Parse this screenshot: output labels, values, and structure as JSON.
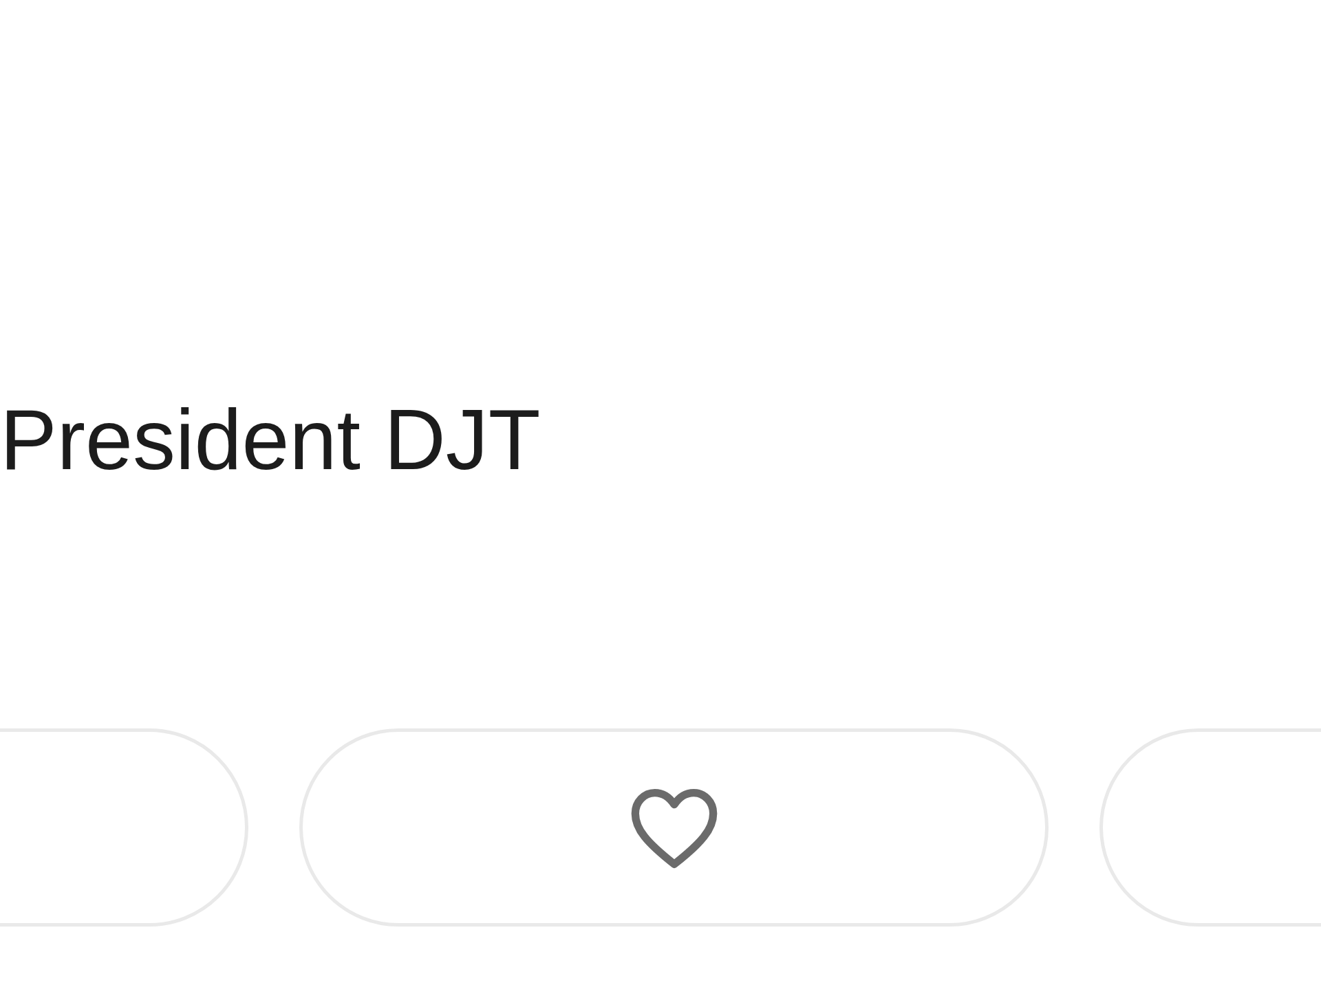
{
  "post": {
    "text": "President DJT"
  },
  "actions": [
    {
      "kind": "other"
    },
    {
      "kind": "like"
    },
    {
      "kind": "other"
    }
  ]
}
